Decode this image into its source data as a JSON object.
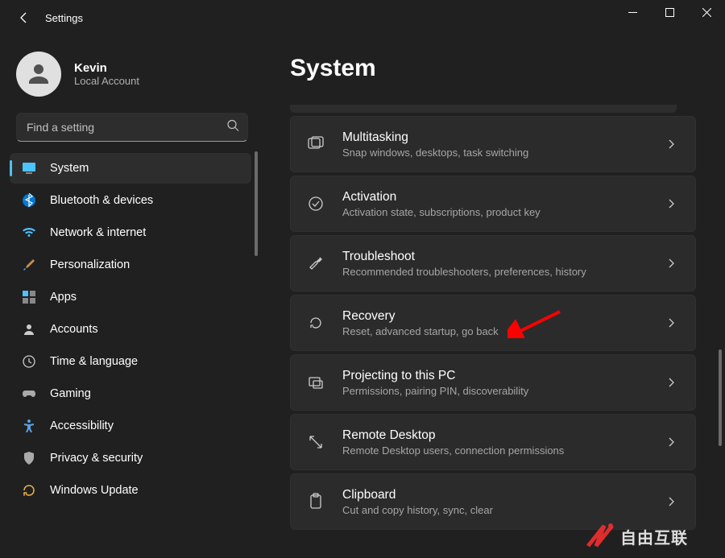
{
  "window": {
    "title": "Settings"
  },
  "profile": {
    "name": "Kevin",
    "sub": "Local Account"
  },
  "search": {
    "placeholder": "Find a setting"
  },
  "sidebar": {
    "items": [
      {
        "label": "System"
      },
      {
        "label": "Bluetooth & devices"
      },
      {
        "label": "Network & internet"
      },
      {
        "label": "Personalization"
      },
      {
        "label": "Apps"
      },
      {
        "label": "Accounts"
      },
      {
        "label": "Time & language"
      },
      {
        "label": "Gaming"
      },
      {
        "label": "Accessibility"
      },
      {
        "label": "Privacy & security"
      },
      {
        "label": "Windows Update"
      }
    ]
  },
  "page": {
    "title": "System"
  },
  "cards": [
    {
      "title": "Multitasking",
      "sub": "Snap windows, desktops, task switching"
    },
    {
      "title": "Activation",
      "sub": "Activation state, subscriptions, product key"
    },
    {
      "title": "Troubleshoot",
      "sub": "Recommended troubleshooters, preferences, history"
    },
    {
      "title": "Recovery",
      "sub": "Reset, advanced startup, go back"
    },
    {
      "title": "Projecting to this PC",
      "sub": "Permissions, pairing PIN, discoverability"
    },
    {
      "title": "Remote Desktop",
      "sub": "Remote Desktop users, connection permissions"
    },
    {
      "title": "Clipboard",
      "sub": "Cut and copy history, sync, clear"
    }
  ],
  "watermark": {
    "text": "自由互联"
  }
}
